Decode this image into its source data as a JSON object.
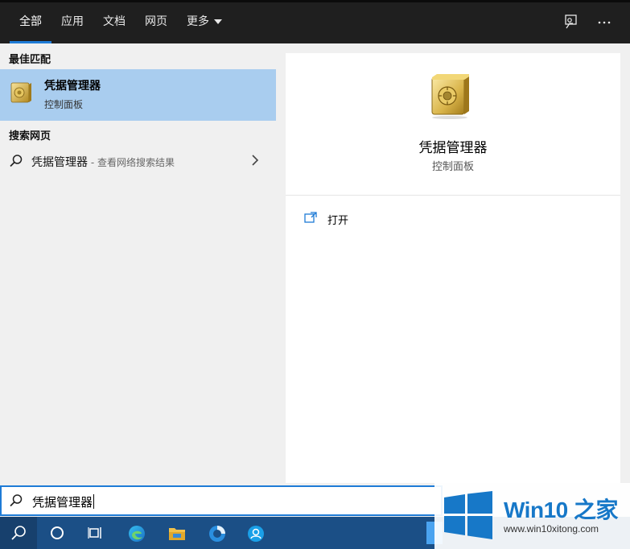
{
  "tabs": [
    {
      "label": "全部",
      "active": true
    },
    {
      "label": "应用"
    },
    {
      "label": "文档"
    },
    {
      "label": "网页"
    },
    {
      "label": "更多"
    }
  ],
  "top_icons": [
    "feedback-icon",
    "more-options-icon"
  ],
  "left": {
    "best_match_header": "最佳匹配",
    "best_match": {
      "title": "凭据管理器",
      "subtitle": "控制面板",
      "icon": "safe-vault-icon"
    },
    "web_header": "搜索网页",
    "web_query": "凭据管理器",
    "web_hint": " - 查看网络搜索结果"
  },
  "right": {
    "title": "凭据管理器",
    "subtitle": "控制面板",
    "open_label": "打开"
  },
  "search": {
    "value": "凭据管理器"
  },
  "taskbar_icons": [
    "search-icon",
    "cortana-icon",
    "task-view-icon",
    "edge-icon",
    "file-explorer-icon",
    "edge-beta-icon",
    "app-user-icon"
  ],
  "watermark": {
    "brand": "Win10 之家",
    "url": "www.win10xitong.com"
  },
  "colors": {
    "accent": "#1e7bd6",
    "selected": "#a9cdef",
    "taskbar": "#1b4f86",
    "topbar": "#1f1f1f"
  }
}
